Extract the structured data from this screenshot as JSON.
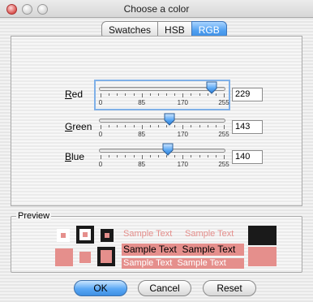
{
  "window": {
    "title": "Choose a color"
  },
  "tabs": [
    {
      "label": "Swatches",
      "active": false
    },
    {
      "label": "HSB",
      "active": false
    },
    {
      "label": "RGB",
      "active": true
    }
  ],
  "sliders": [
    {
      "label_prefix": "",
      "label_mnemonic": "R",
      "label_rest": "ed",
      "value": "229",
      "max": 255
    },
    {
      "label_prefix": "",
      "label_mnemonic": "G",
      "label_rest": "reen",
      "value": "143",
      "max": 255
    },
    {
      "label_prefix": "",
      "label_mnemonic": "B",
      "label_rest": "lue",
      "value": "140",
      "max": 255
    }
  ],
  "tick_labels": [
    "0",
    "85",
    "170",
    "255"
  ],
  "preview": {
    "legend": "Preview",
    "sample_text": "Sample Text",
    "color": "#e58f8c",
    "dark": "#1a1a1a"
  },
  "buttons": {
    "ok": "OK",
    "cancel": "Cancel",
    "reset": "Reset"
  }
}
